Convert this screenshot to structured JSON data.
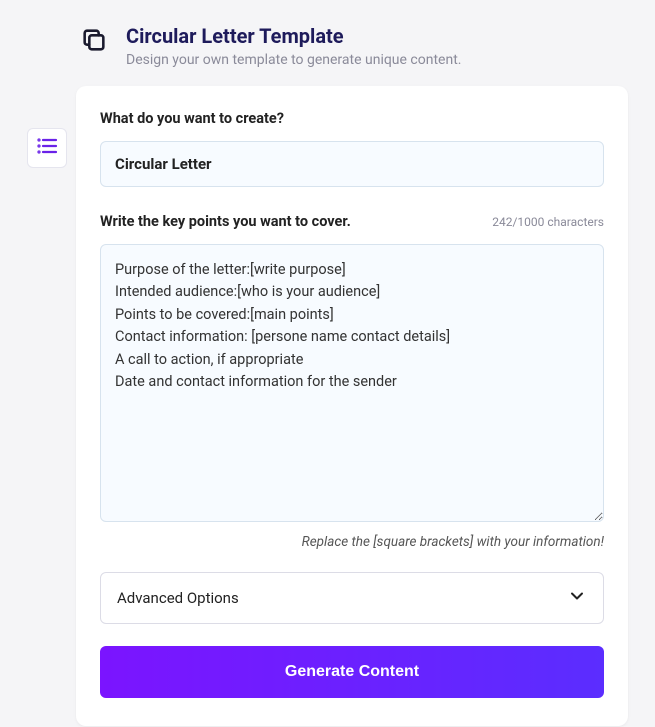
{
  "header": {
    "title": "Circular Letter Template",
    "subtitle": "Design your own template to generate unique content."
  },
  "form": {
    "create_label": "What do you want to create?",
    "create_value": "Circular Letter",
    "keypoints_label": "Write the key points you want to cover.",
    "char_counter": "242/1000 characters",
    "keypoints_value": "Purpose of the letter:[write purpose]\nIntended audience:[who is your audience]\nPoints to be covered:[main points]\nContact information: [persone name contact details]\nA call to action, if appropriate\nDate and contact information for the sender",
    "hint": "Replace the [square brackets] with your information!",
    "advanced_label": "Advanced Options",
    "generate_label": "Generate Content"
  }
}
